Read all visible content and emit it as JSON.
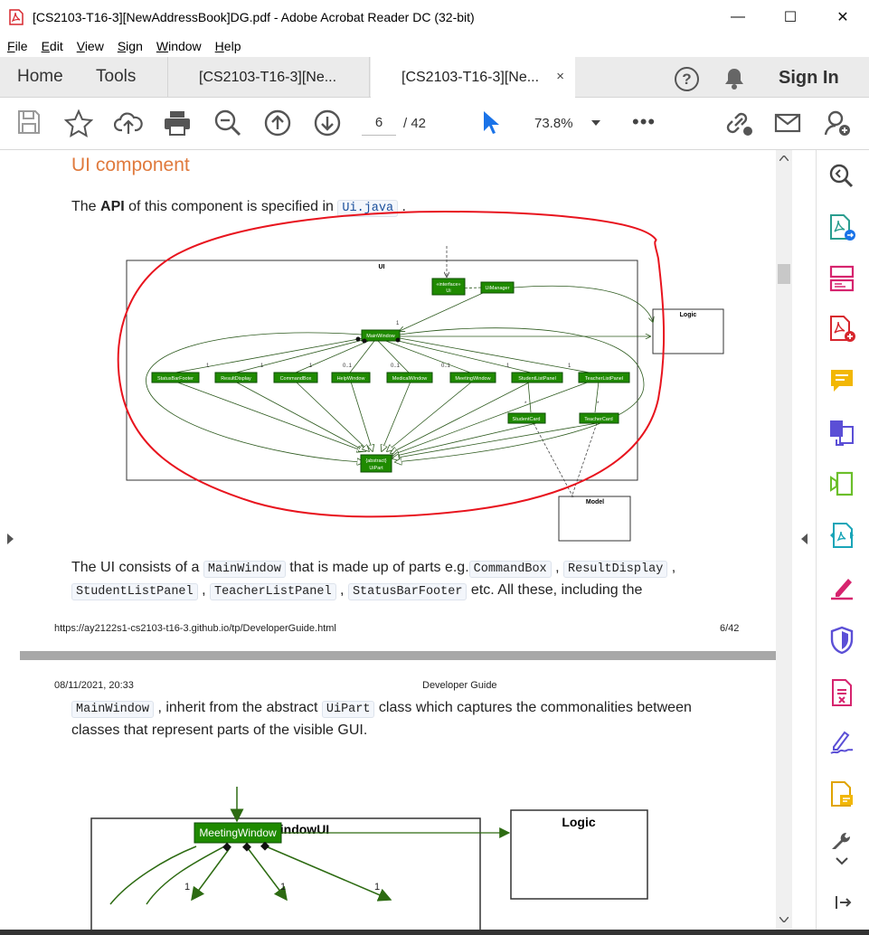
{
  "window": {
    "title": "[CS2103-T16-3][NewAddressBook]DG.pdf - Adobe Acrobat Reader DC (32-bit)",
    "minimize": "—",
    "maximize": "☐",
    "close": "✕"
  },
  "menu": [
    "File",
    "Edit",
    "View",
    "Sign",
    "Window",
    "Help"
  ],
  "tabs": {
    "home": "Home",
    "tools": "Tools",
    "doc1": "[CS2103-T16-3][Ne...",
    "doc2": "[CS2103-T16-3][Ne...",
    "close": "×",
    "help": "?",
    "sign_in": "Sign In"
  },
  "toolbar": {
    "page_current": "6",
    "page_total": "/ 42",
    "zoom": "73.8%",
    "more": "•••"
  },
  "page1": {
    "heading": "UI component",
    "intro_pre": "The ",
    "intro_bold": "API",
    "intro_mid": " of this component is specified in ",
    "intro_code": "Ui.java",
    "intro_post": " .",
    "para_a1": "The UI consists of a ",
    "para_a_code1": "MainWindow",
    "para_a2": " that is made up of parts e.g.",
    "para_a_code2": "CommandBox",
    "para_a3": " , ",
    "para_a_code3": "ResultDisplay",
    "para_a4": " ,",
    "para_b_code1": "StudentListPanel",
    "para_b1": " , ",
    "para_b_code2": "TeacherListPanel",
    "para_b2": " , ",
    "para_b_code3": "StatusBarFooter",
    "para_b3": " etc. All these, including the",
    "footer_url": "https://ay2122s1-cs2103-t16-3.github.io/tp/DeveloperGuide.html",
    "footer_page": "6/42"
  },
  "diagram1": {
    "frame_title": "UI",
    "interface_label": "«interface»\nUi",
    "ui_manager": "UiManager",
    "logic": "Logic",
    "model": "Model",
    "main_window": "MainWindow",
    "parts": [
      "StatusBarFooter",
      "ResultDisplay",
      "CommandBox",
      "HelpWindow",
      "MedicalWindow",
      "MeetingWindow",
      "StudentListPanel",
      "TeacherListPanel"
    ],
    "multiplicities": [
      "1",
      "1",
      "1",
      "0..1",
      "0..1",
      "0..1",
      "1",
      "1"
    ],
    "student_card": "StudentCard",
    "teacher_card": "TeacherCard",
    "uipart": "{abstract}\nUiPart",
    "main_mult": "1",
    "star": "*"
  },
  "page2": {
    "header_date": "08/11/2021, 20:33",
    "header_title": "Developer Guide",
    "line1_code": "MainWindow",
    "line1_a": " , inherit from the abstract ",
    "line1_code2": "UiPart",
    "line1_b": " class which captures the commonalities between",
    "line2": "classes that represent parts of the visible GUI."
  },
  "diagram2": {
    "frame_title": "MeetingWindowUI",
    "meeting_window": "MeetingWindow",
    "logic": "Logic",
    "mult1": "1",
    "mult2": "1",
    "mult3": "1"
  },
  "colors": {
    "heading": "#e07a3d",
    "uml_green": "#1f8a00",
    "annotation_red": "#e8141e",
    "adobe_red": "#d7262d"
  }
}
